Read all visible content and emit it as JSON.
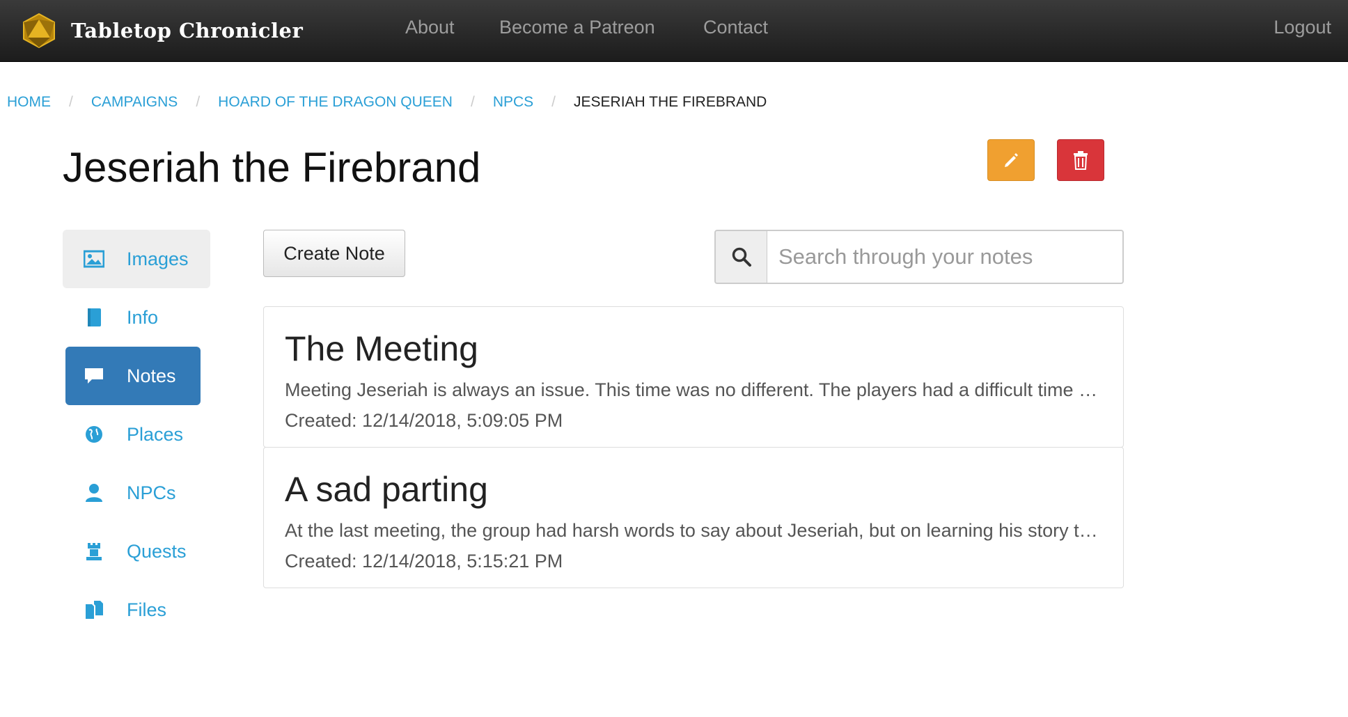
{
  "navbar": {
    "brand": "Tabletop Chronicler",
    "links": {
      "about": "About",
      "patreon": "Become a Patreon",
      "contact": "Contact"
    },
    "logout": "Logout"
  },
  "breadcrumb": {
    "home": "HOME",
    "campaigns": "CAMPAIGNS",
    "campaign": "HOARD OF THE DRAGON QUEEN",
    "npcs": "NPCS",
    "current": "JESERIAH THE FIREBRAND",
    "separator": "/"
  },
  "page": {
    "title": "Jeseriah the Firebrand"
  },
  "sidenav": {
    "images": "Images",
    "info": "Info",
    "notes": "Notes",
    "places": "Places",
    "npcs": "NPCs",
    "quests": "Quests",
    "files": "Files"
  },
  "toolbar": {
    "create_note": "Create Note",
    "search_placeholder": "Search through your notes"
  },
  "notes": [
    {
      "title": "The Meeting",
      "excerpt": "Meeting Jeseriah is always an issue. This time was no different. The players had a difficult time with him before they discovered his true intentions.",
      "created": "Created: 12/14/2018, 5:09:05 PM"
    },
    {
      "title": "A sad parting",
      "excerpt": "At the last meeting, the group had harsh words to say about Jeseriah, but on learning his story they came to understand him.",
      "created": "Created: 12/14/2018, 5:15:21 PM"
    }
  ],
  "colors": {
    "link": "#2a9fd6",
    "active": "#337ab7",
    "edit": "#f0a030",
    "delete": "#d9353a"
  }
}
